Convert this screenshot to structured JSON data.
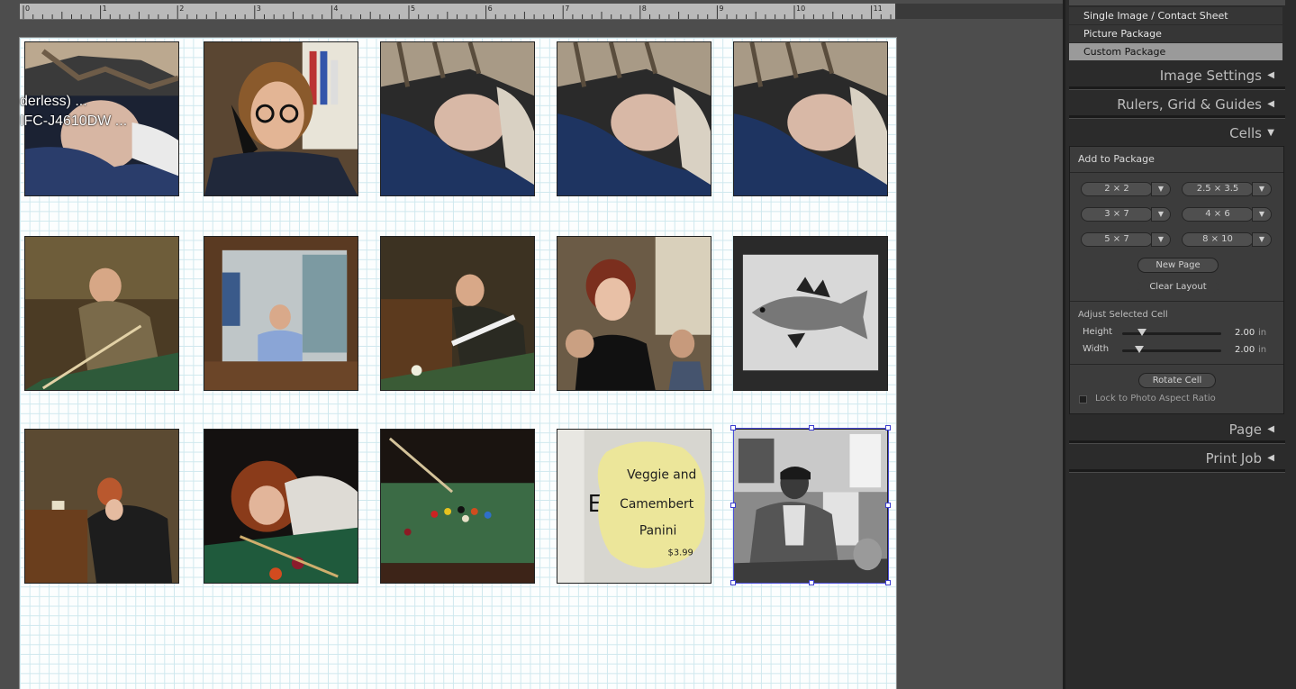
{
  "ruler": {
    "numbers": [
      "0",
      "1",
      "2",
      "3",
      "4",
      "5",
      "6",
      "7",
      "8",
      "9",
      "10",
      "11"
    ]
  },
  "overlay": {
    "line1": "derless) ...",
    "line2": "IFC-J4610DW ..."
  },
  "cells": [
    {
      "id": "c1",
      "subject": "sleeping-baby-in-car-seat"
    },
    {
      "id": "c2",
      "subject": "woman-on-phone-with-glasses"
    },
    {
      "id": "c3",
      "subject": "sleeping-baby-blue-blanket"
    },
    {
      "id": "c4",
      "subject": "sleeping-baby-blue-blanket"
    },
    {
      "id": "c5",
      "subject": "sleeping-baby-blue-blanket"
    },
    {
      "id": "c6",
      "subject": "man-playing-pool"
    },
    {
      "id": "c7",
      "subject": "woman-at-bar-window"
    },
    {
      "id": "c8",
      "subject": "bald-man-playing-pool"
    },
    {
      "id": "c9",
      "subject": "woman-posing-at-party"
    },
    {
      "id": "c10",
      "subject": "framed-fish-print-bw"
    },
    {
      "id": "c11",
      "subject": "woman-leaning-over-pool-table"
    },
    {
      "id": "c12",
      "subject": "red-haired-woman-shooting-pool"
    },
    {
      "id": "c13",
      "subject": "pool-table-balls-green"
    },
    {
      "id": "c14",
      "subject": "handwritten-sign-note",
      "sign": {
        "line1": "Veggie and",
        "line2": "Camembert",
        "line3": "Panini",
        "price": "$3.99"
      }
    },
    {
      "id": "c15",
      "subject": "man-sitting-bw-selected"
    }
  ],
  "panel": {
    "layout_styles": [
      {
        "label": "Single Image / Contact Sheet",
        "selected": false
      },
      {
        "label": "Picture Package",
        "selected": false
      },
      {
        "label": "Custom Package",
        "selected": true
      }
    ],
    "sections": {
      "image_settings": "Image Settings",
      "rulers": "Rulers, Grid & Guides",
      "cells": "Cells",
      "page": "Page",
      "print_job": "Print Job"
    },
    "add_to_package": "Add to Package",
    "sizes": [
      [
        "2 × 2",
        "2.5 × 3.5"
      ],
      [
        "3 × 7",
        "4 × 6"
      ],
      [
        "5 × 7",
        "8 × 10"
      ]
    ],
    "new_page": "New Page",
    "clear_layout": "Clear Layout",
    "adjust_cell": "Adjust Selected Cell",
    "height_label": "Height",
    "width_label": "Width",
    "height_value": "2.00",
    "width_value": "2.00",
    "unit": "in",
    "height_fraction": 0.2,
    "width_fraction": 0.17,
    "rotate_cell": "Rotate Cell",
    "lock_aspect": "Lock to Photo Aspect Ratio",
    "tri_collapsed": "◀",
    "tri_expanded": "▼",
    "dropdown_arrow": "▼"
  }
}
